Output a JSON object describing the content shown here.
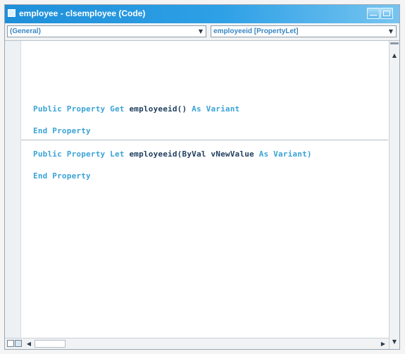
{
  "window": {
    "title": "employee - clsemployee (Code)"
  },
  "combos": {
    "object": "(General)",
    "procedure": "employeeid [PropertyLet]"
  },
  "code": [
    {
      "kw1": "Public Property Get ",
      "name": "employeeid() ",
      "kw2": "As Variant"
    },
    {
      "kw1": "End Property",
      "name": "",
      "kw2": ""
    },
    {
      "kw1": "Public Property Let ",
      "name": "employeeid(ByVal vNewValue ",
      "kw2": "As Variant)"
    },
    {
      "kw1": "End Property",
      "name": "",
      "kw2": ""
    }
  ],
  "colors": {
    "title_bar": "#1e8fd9",
    "keyword": "#3aa3d6",
    "identifier": "#1f3e5e"
  },
  "icons": {
    "window": "code-window-icon",
    "minimize": "minimize-icon",
    "maximize": "maximize-icon",
    "dropdown": "chevron-down-icon"
  }
}
